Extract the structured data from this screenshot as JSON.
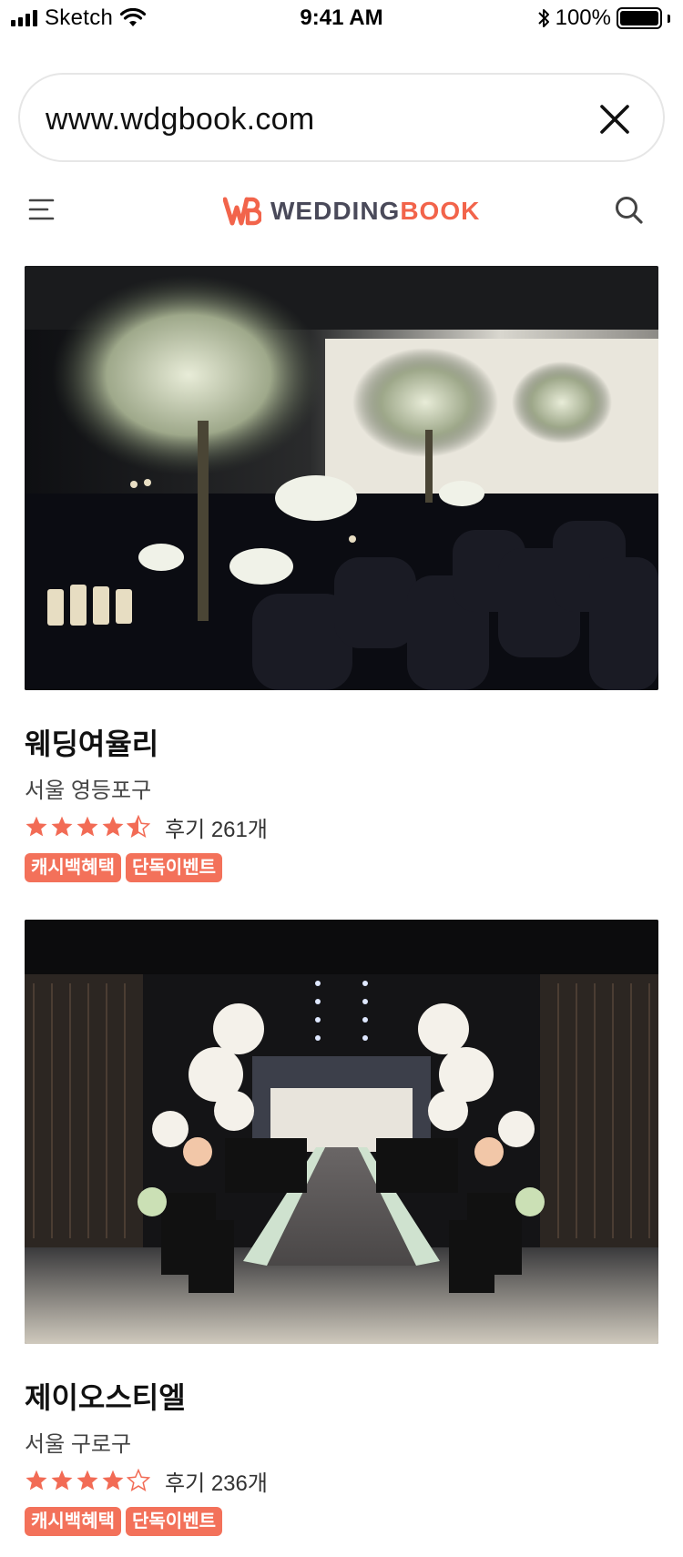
{
  "status_bar": {
    "carrier": "Sketch",
    "time": "9:41 AM",
    "battery": "100%"
  },
  "url_bar": {
    "url": "www.wdgbook.com"
  },
  "header": {
    "logo_part1": "WEDDING",
    "logo_part2": "BOOK"
  },
  "colors": {
    "brand": "#f2644b",
    "tag": "#f3715a",
    "star": "#f26b55"
  },
  "venues": [
    {
      "name": "웨딩여율리",
      "location": "서울 영등포구",
      "rating": 4.5,
      "reviews": "후기 261개",
      "tags": [
        "캐시백혜택",
        "단독이벤트"
      ]
    },
    {
      "name": "제이오스티엘",
      "location": "서울 구로구",
      "rating": 4,
      "reviews": "후기 236개",
      "tags": [
        "캐시백혜택",
        "단독이벤트"
      ]
    }
  ]
}
